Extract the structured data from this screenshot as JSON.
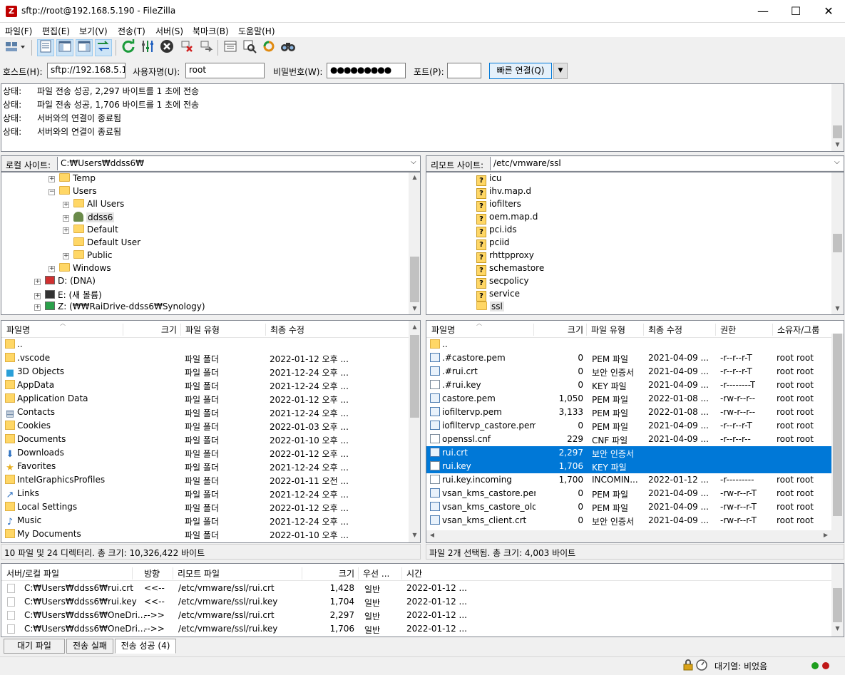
{
  "window": {
    "title": "sftp://root@192.168.5.190 - FileZilla",
    "icon_letter": "Z",
    "controls": {
      "minimize": "—",
      "maximize": "☐",
      "close": "✕"
    }
  },
  "menu": [
    "파일(F)",
    "편집(E)",
    "보기(V)",
    "전송(T)",
    "서버(S)",
    "북마크(B)",
    "도움말(H)"
  ],
  "quickconnect": {
    "host_label": "호스트(H):",
    "host_value": "sftp://192.168.5.190",
    "user_label": "사용자명(U):",
    "user_value": "root",
    "pass_label": "비밀번호(W):",
    "pass_value": "●●●●●●●●●",
    "port_label": "포트(P):",
    "port_value": "",
    "button": "빠른 연결(Q)"
  },
  "log": [
    {
      "label": "상태:",
      "text": "파일 전송 성공, 2,297 바이트를 1 초에 전송"
    },
    {
      "label": "상태:",
      "text": "파일 전송 성공, 1,706 바이트를 1 초에 전송"
    },
    {
      "label": "상태:",
      "text": "서버와의 연결이 종료됨"
    },
    {
      "label": "상태:",
      "text": "서버와의 연결이 종료됨"
    }
  ],
  "local": {
    "site_label": "로컬 사이트:",
    "path": "C:₩Users₩ddss6₩",
    "tree": [
      {
        "name": "Temp",
        "indent": 1,
        "expander": "+"
      },
      {
        "name": "Users",
        "indent": 1,
        "expander": "-"
      },
      {
        "name": "All Users",
        "indent": 2,
        "expander": "+"
      },
      {
        "name": "ddss6",
        "indent": 2,
        "expander": "+",
        "user": true
      },
      {
        "name": "Default",
        "indent": 2,
        "expander": "+"
      },
      {
        "name": "Default User",
        "indent": 2,
        "expander": ""
      },
      {
        "name": "Public",
        "indent": 2,
        "expander": "+"
      },
      {
        "name": "Windows",
        "indent": 1,
        "expander": "+"
      },
      {
        "name": "D: (DNA)",
        "indent": 0,
        "expander": "+",
        "drive": "red"
      },
      {
        "name": "E: (새 볼륨)",
        "indent": 0,
        "expander": "+",
        "drive": "black"
      },
      {
        "name": "Z: (₩₩RaiDrive-ddss6₩Synology)",
        "indent": 0,
        "expander": "+",
        "drive": "green"
      }
    ],
    "columns": [
      "파일명",
      "크기",
      "파일 유형",
      "최종 수정"
    ],
    "files": [
      {
        "name": "..",
        "size": "",
        "type": "",
        "modified": "",
        "icon": "fold"
      },
      {
        "name": ".vscode",
        "size": "",
        "type": "파일 폴더",
        "modified": "2022-01-12 오후 ...",
        "icon": "fold"
      },
      {
        "name": "3D Objects",
        "size": "",
        "type": "파일 폴더",
        "modified": "2021-12-24 오후 ...",
        "icon": "cube"
      },
      {
        "name": "AppData",
        "size": "",
        "type": "파일 폴더",
        "modified": "2021-12-24 오후 ...",
        "icon": "fold"
      },
      {
        "name": "Application Data",
        "size": "",
        "type": "파일 폴더",
        "modified": "2022-01-12 오후 ...",
        "icon": "fold"
      },
      {
        "name": "Contacts",
        "size": "",
        "type": "파일 폴더",
        "modified": "2021-12-24 오후 ...",
        "icon": "card"
      },
      {
        "name": "Cookies",
        "size": "",
        "type": "파일 폴더",
        "modified": "2022-01-03 오후 ...",
        "icon": "fold"
      },
      {
        "name": "Documents",
        "size": "",
        "type": "파일 폴더",
        "modified": "2022-01-10 오후 ...",
        "icon": "fold"
      },
      {
        "name": "Downloads",
        "size": "",
        "type": "파일 폴더",
        "modified": "2022-01-12 오후 ...",
        "icon": "down"
      },
      {
        "name": "Favorites",
        "size": "",
        "type": "파일 폴더",
        "modified": "2021-12-24 오후 ...",
        "icon": "star"
      },
      {
        "name": "IntelGraphicsProfiles",
        "size": "",
        "type": "파일 폴더",
        "modified": "2022-01-11 오전 ...",
        "icon": "fold"
      },
      {
        "name": "Links",
        "size": "",
        "type": "파일 폴더",
        "modified": "2021-12-24 오후 ...",
        "icon": "link"
      },
      {
        "name": "Local Settings",
        "size": "",
        "type": "파일 폴더",
        "modified": "2022-01-12 오후 ...",
        "icon": "fold"
      },
      {
        "name": "Music",
        "size": "",
        "type": "파일 폴더",
        "modified": "2021-12-24 오후 ...",
        "icon": "music"
      },
      {
        "name": "My Documents",
        "size": "",
        "type": "파일 폴더",
        "modified": "2022-01-10 오후 ...",
        "icon": "fold"
      }
    ],
    "status": "10 파일 및 24 디렉터리. 총 크기: 10,326,422 바이트"
  },
  "remote": {
    "site_label": "리모트 사이트:",
    "path": "/etc/vmware/ssl",
    "tree": [
      "icu",
      "ihv.map.d",
      "iofilters",
      "oem.map.d",
      "pci.ids",
      "pciid",
      "rhttpproxy",
      "schemastore",
      "secpolicy",
      "service",
      "ssl"
    ],
    "columns": [
      "파일명",
      "크기",
      "파일 유형",
      "최종 수정",
      "권한",
      "소유자/그룹"
    ],
    "files": [
      {
        "name": "..",
        "size": "",
        "type": "",
        "modified": "",
        "perm": "",
        "owner": "",
        "icon": "fold",
        "selected": false
      },
      {
        "name": ".#castore.pem",
        "size": "0",
        "type": "PEM 파일",
        "modified": "2021-04-09 ...",
        "perm": "-r--r--r-T",
        "owner": "root root",
        "icon": "cert",
        "selected": false
      },
      {
        "name": ".#rui.crt",
        "size": "0",
        "type": "보안 인증서",
        "modified": "2021-04-09 ...",
        "perm": "-r--r--r-T",
        "owner": "root root",
        "icon": "cert",
        "selected": false
      },
      {
        "name": ".#rui.key",
        "size": "0",
        "type": "KEY 파일",
        "modified": "2021-04-09 ...",
        "perm": "-r--------T",
        "owner": "root root",
        "icon": "doc",
        "selected": false
      },
      {
        "name": "castore.pem",
        "size": "1,050",
        "type": "PEM 파일",
        "modified": "2022-01-08 ...",
        "perm": "-rw-r--r--",
        "owner": "root root",
        "icon": "cert",
        "selected": false
      },
      {
        "name": "iofiltervp.pem",
        "size": "3,133",
        "type": "PEM 파일",
        "modified": "2022-01-08 ...",
        "perm": "-rw-r--r--",
        "owner": "root root",
        "icon": "cert",
        "selected": false
      },
      {
        "name": "iofiltervp_castore.pem",
        "size": "0",
        "type": "PEM 파일",
        "modified": "2021-04-09 ...",
        "perm": "-r--r--r-T",
        "owner": "root root",
        "icon": "cert",
        "selected": false
      },
      {
        "name": "openssl.cnf",
        "size": "229",
        "type": "CNF 파일",
        "modified": "2021-04-09 ...",
        "perm": "-r--r--r--",
        "owner": "root root",
        "icon": "doc",
        "selected": false
      },
      {
        "name": "rui.crt",
        "size": "2,297",
        "type": "보안 인증서",
        "modified": "",
        "perm": "",
        "owner": "",
        "icon": "cert",
        "selected": true
      },
      {
        "name": "rui.key",
        "size": "1,706",
        "type": "KEY 파일",
        "modified": "",
        "perm": "",
        "owner": "",
        "icon": "doc",
        "selected": true
      },
      {
        "name": "rui.key.incoming",
        "size": "1,700",
        "type": "INCOMIN...",
        "modified": "2022-01-12 ...",
        "perm": "-r---------",
        "owner": "root root",
        "icon": "doc",
        "selected": false
      },
      {
        "name": "vsan_kms_castore.pem",
        "size": "0",
        "type": "PEM 파일",
        "modified": "2021-04-09 ...",
        "perm": "-rw-r--r-T",
        "owner": "root root",
        "icon": "cert",
        "selected": false
      },
      {
        "name": "vsan_kms_castore_old...",
        "size": "0",
        "type": "PEM 파일",
        "modified": "2021-04-09 ...",
        "perm": "-rw-r--r-T",
        "owner": "root root",
        "icon": "cert",
        "selected": false
      },
      {
        "name": "vsan_kms_client.crt",
        "size": "0",
        "type": "보안 인증서",
        "modified": "2021-04-09 ...",
        "perm": "-rw-r--r-T",
        "owner": "root root",
        "icon": "cert",
        "selected": false
      }
    ],
    "status": "파일 2개 선택됨. 총 크기: 4,003 바이트"
  },
  "queue": {
    "columns": [
      "서버/로컬 파일",
      "방향",
      "리모트 파일",
      "크기",
      "우선 ...",
      "시간"
    ],
    "rows": [
      {
        "local": "C:₩Users₩ddss6₩rui.crt",
        "dir": "<<--",
        "remote": "/etc/vmware/ssl/rui.crt",
        "size": "1,428",
        "priority": "일반",
        "time": "2022-01-12 ..."
      },
      {
        "local": "C:₩Users₩ddss6₩rui.key",
        "dir": "<<--",
        "remote": "/etc/vmware/ssl/rui.key",
        "size": "1,704",
        "priority": "일반",
        "time": "2022-01-12 ..."
      },
      {
        "local": "C:₩Users₩ddss6₩OneDri...",
        "dir": "-->>",
        "remote": "/etc/vmware/ssl/rui.crt",
        "size": "2,297",
        "priority": "일반",
        "time": "2022-01-12 ..."
      },
      {
        "local": "C:₩Users₩ddss6₩OneDri...",
        "dir": "-->>",
        "remote": "/etc/vmware/ssl/rui.key",
        "size": "1,706",
        "priority": "일반",
        "time": "2022-01-12 ..."
      }
    ],
    "tabs": [
      "대기 파일",
      "전송 실패",
      "전송 성공 (4)"
    ]
  },
  "statusbar": {
    "queue_text": "대기열: 비었음"
  },
  "colors": {
    "selection": "#0078d7",
    "accent": "#0078d7",
    "led_green": "#1e9e1e",
    "led_red": "#c01818"
  }
}
